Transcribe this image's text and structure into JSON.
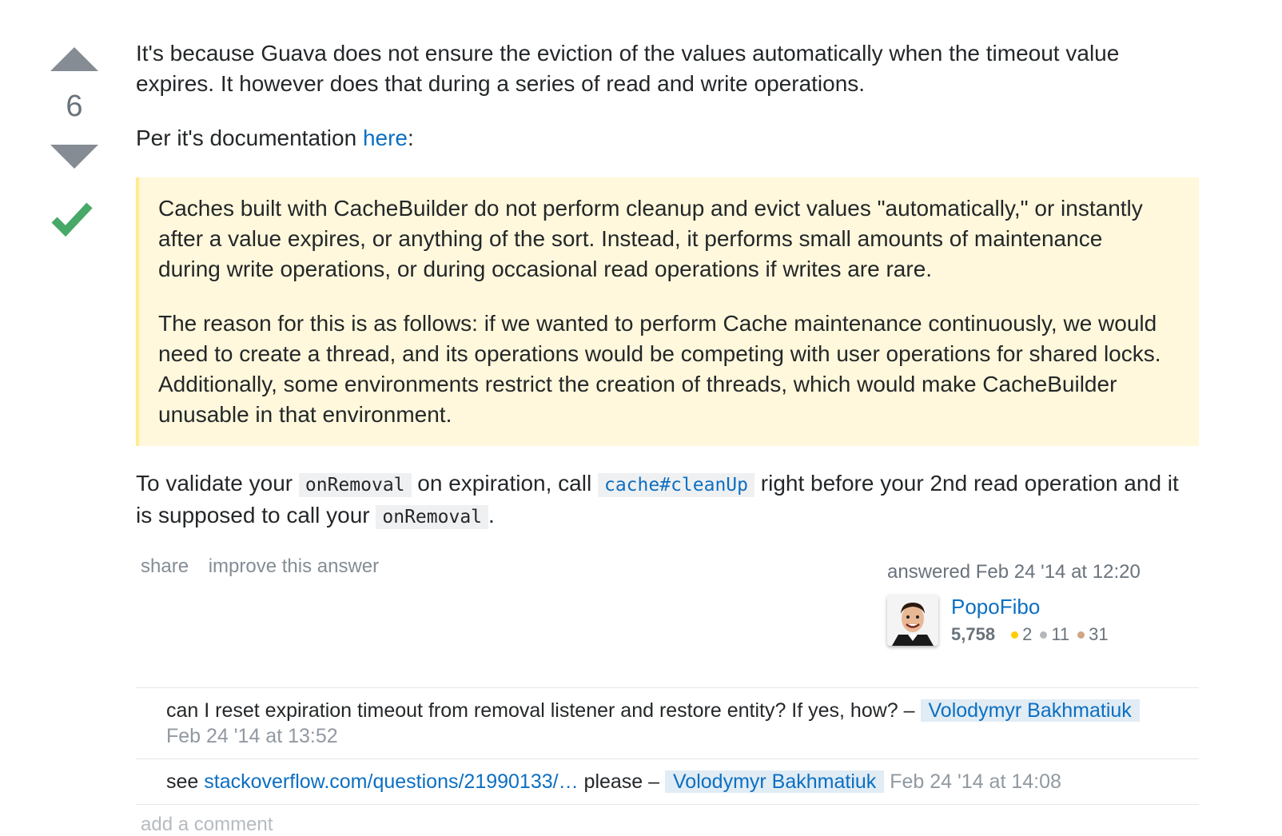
{
  "vote": {
    "count": "6"
  },
  "post": {
    "paragraph1": "It's because Guava does not ensure the eviction of the values automatically when the timeout value expires. It however does that during a series of read and write operations.",
    "paragraph2_prefix": "Per it's documentation ",
    "paragraph2_link": "here",
    "paragraph2_suffix": ":",
    "quote1": "Caches built with CacheBuilder do not perform cleanup and evict values \"automatically,\" or instantly after a value expires, or anything of the sort. Instead, it performs small amounts of maintenance during write operations, or during occasional read operations if writes are rare.",
    "quote2": "The reason for this is as follows: if we wanted to perform Cache maintenance continuously, we would need to create a thread, and its operations would be competing with user operations for shared locks. Additionally, some environments restrict the creation of threads, which would make CacheBuilder unusable in that environment.",
    "final_part1": "To validate your ",
    "final_code1": "onRemoval",
    "final_part2": " on expiration, call ",
    "final_code2": "cache#cleanUp",
    "final_part3": " right before your 2nd read operation and it is supposed to call your ",
    "final_code3": "onRemoval",
    "final_part4": "."
  },
  "menu": {
    "share": "share",
    "improve": "improve this answer"
  },
  "user": {
    "action_time": "answered Feb 24 '14 at 12:20",
    "name": "PopoFibo",
    "reputation": "5,758",
    "gold": "2",
    "silver": "11",
    "bronze": "31"
  },
  "comments": [
    {
      "text": "can I reset expiration timeout from removal listener and restore entity? If yes, how? –",
      "user": "Volodymyr Bakhmatiuk",
      "date": "Feb 24 '14 at 13:52"
    },
    {
      "prefix": "see ",
      "link": "stackoverflow.com/questions/21990133/…",
      "suffix": " please –",
      "user": "Volodymyr Bakhmatiuk",
      "date": "Feb 24 '14 at 14:08"
    }
  ],
  "add_comment": "add a comment",
  "colors": {
    "link": "#0c6fc2",
    "accepted": "#48a868",
    "quote_bg": "#fff8dc",
    "gold": "#ffcc01",
    "silver": "#b4b8bc",
    "bronze": "#d1a684"
  }
}
